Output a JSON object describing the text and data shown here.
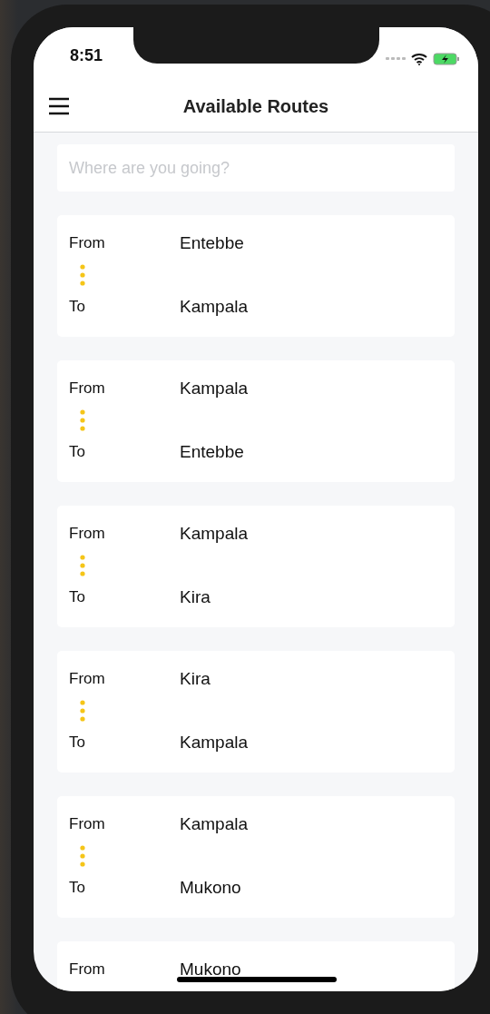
{
  "status_bar": {
    "time": "8:51"
  },
  "header": {
    "title": "Available Routes"
  },
  "search": {
    "placeholder": "Where are you going?"
  },
  "routes": [
    {
      "from_label": "From",
      "from": "Entebbe",
      "to_label": "To",
      "to": "Kampala"
    },
    {
      "from_label": "From",
      "from": "Kampala",
      "to_label": "To",
      "to": "Entebbe"
    },
    {
      "from_label": "From",
      "from": "Kampala",
      "to_label": "To",
      "to": "Kira"
    },
    {
      "from_label": "From",
      "from": "Kira",
      "to_label": "To",
      "to": "Kampala"
    },
    {
      "from_label": "From",
      "from": "Kampala",
      "to_label": "To",
      "to": "Mukono"
    },
    {
      "from_label": "From",
      "from": "Mukono"
    }
  ]
}
